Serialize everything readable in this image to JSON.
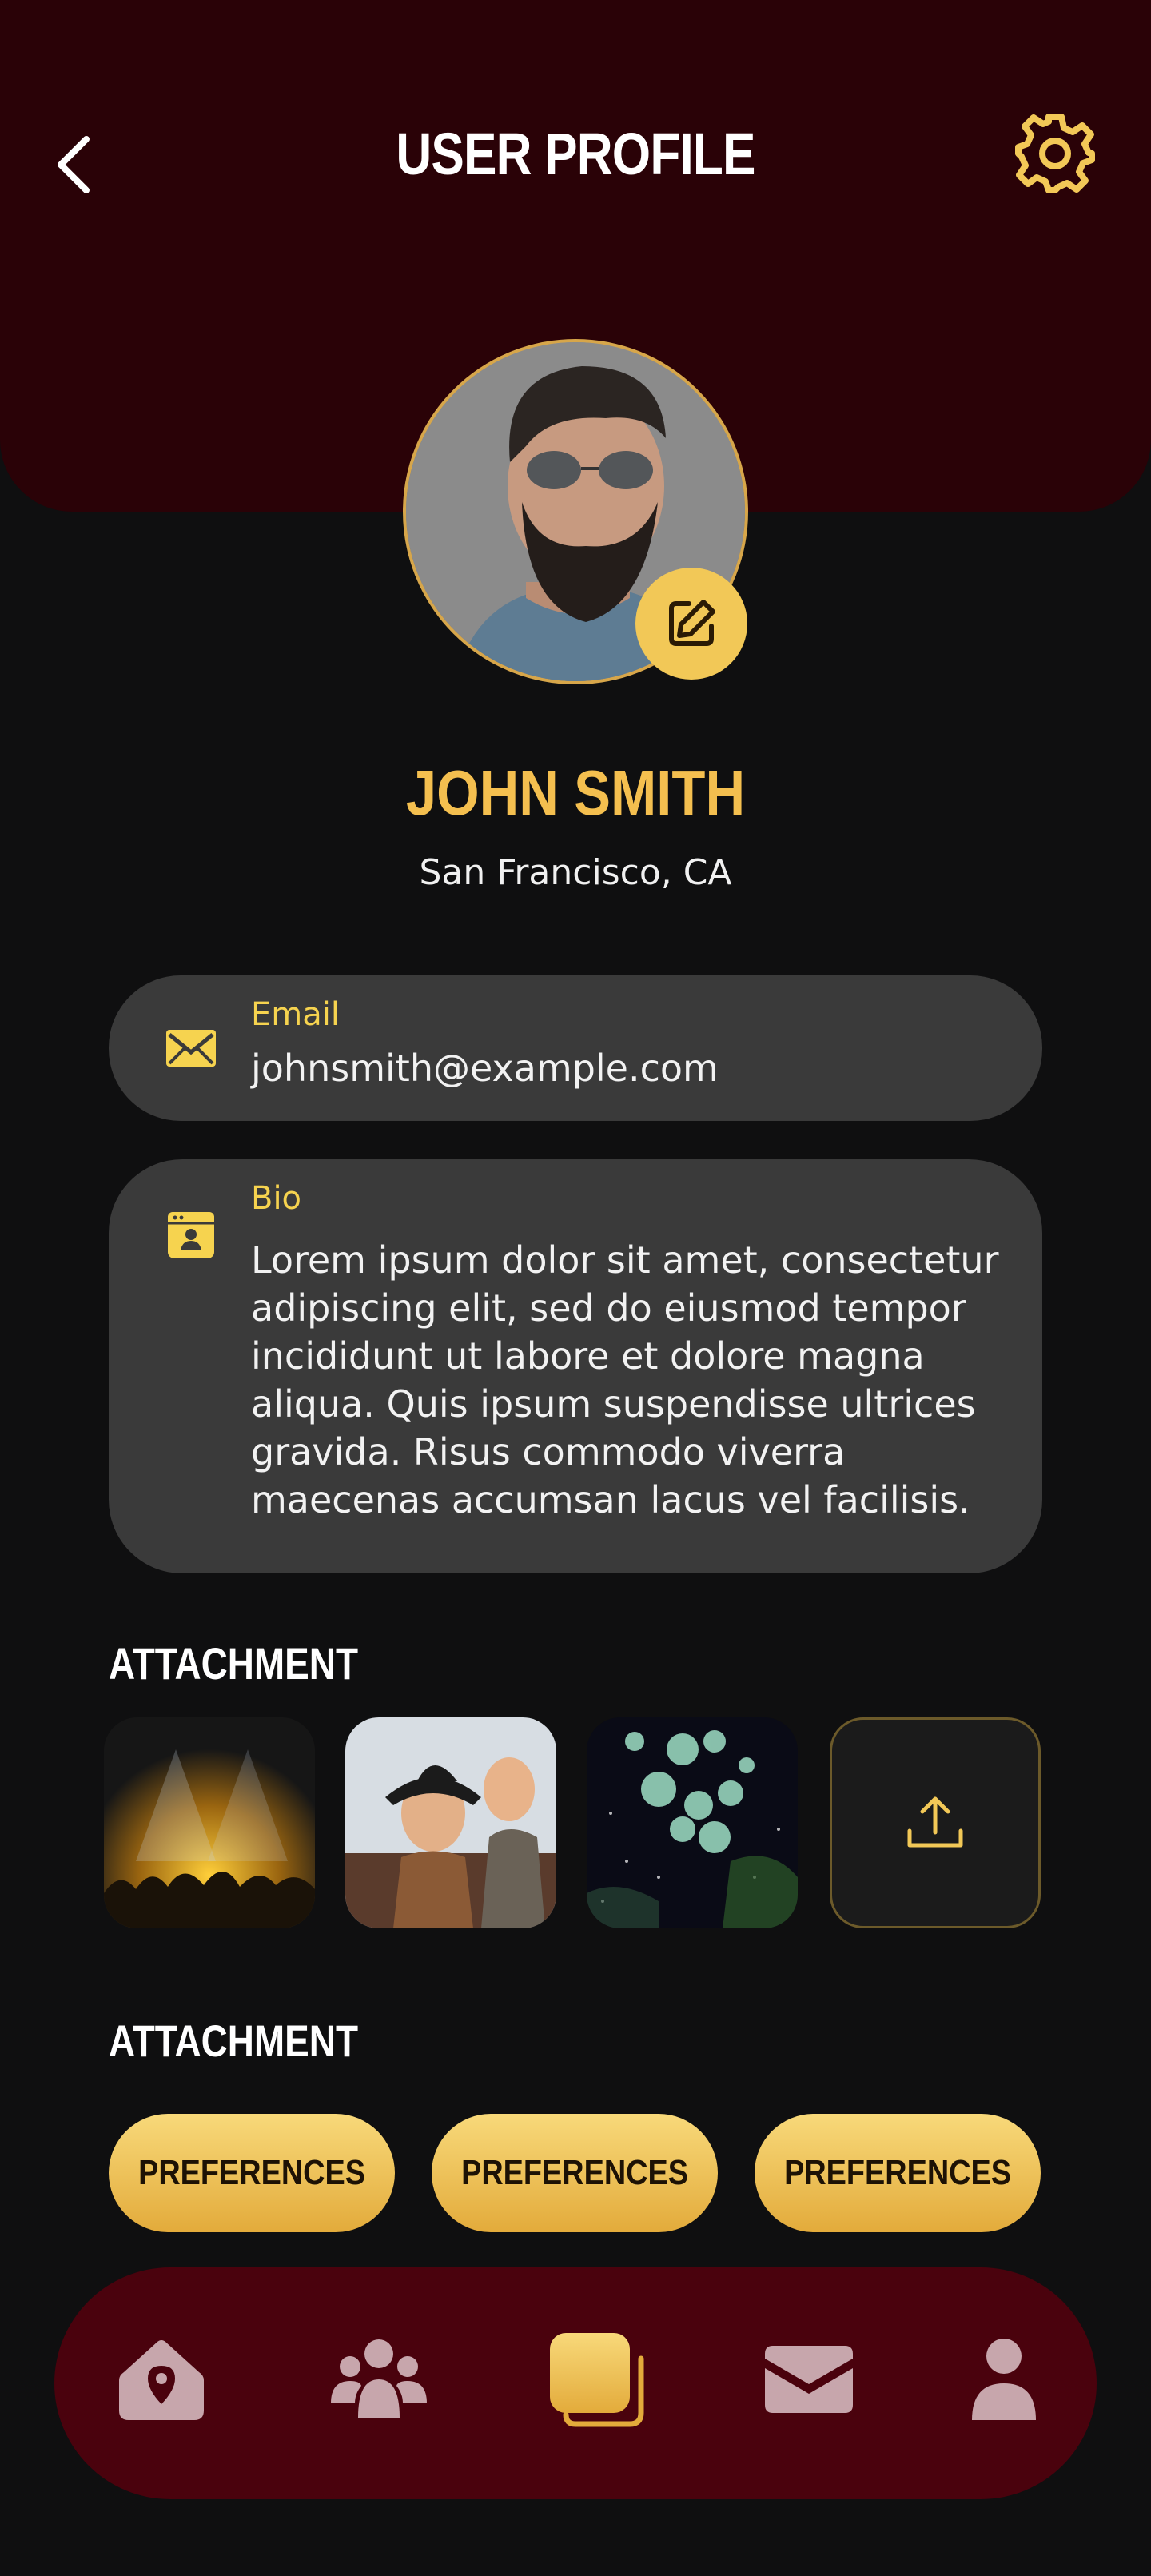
{
  "header": {
    "title": "USER PROFILE"
  },
  "profile": {
    "name": "JOHN SMITH",
    "location": "San Francisco, CA"
  },
  "email": {
    "label": "Email",
    "value": "johnsmith@example.com"
  },
  "bio": {
    "label": "Bio",
    "value": "Lorem ipsum dolor sit amet, consectetur adipiscing elit, sed do eiusmod tempor incididunt ut labore et dolore magna aliqua. Quis ipsum suspendisse ultrices gravida. Risus commodo viverra maecenas accumsan lacus vel facilisis."
  },
  "attachments": {
    "title": "ATTACHMENT"
  },
  "preferences": {
    "title": "ATTACHMENT",
    "buttons": [
      "PREFERENCES",
      "PREFERENCES",
      "PREFERENCES"
    ]
  },
  "nav": {
    "items": [
      "location-icon",
      "users-icon",
      "gallery-icon",
      "mail-icon",
      "profile-icon"
    ],
    "active": "gallery-icon"
  },
  "colors": {
    "accent": "#f4bf4f",
    "header": "#2a0207",
    "nav": "#4a020d",
    "card": "#3a3a3a"
  }
}
